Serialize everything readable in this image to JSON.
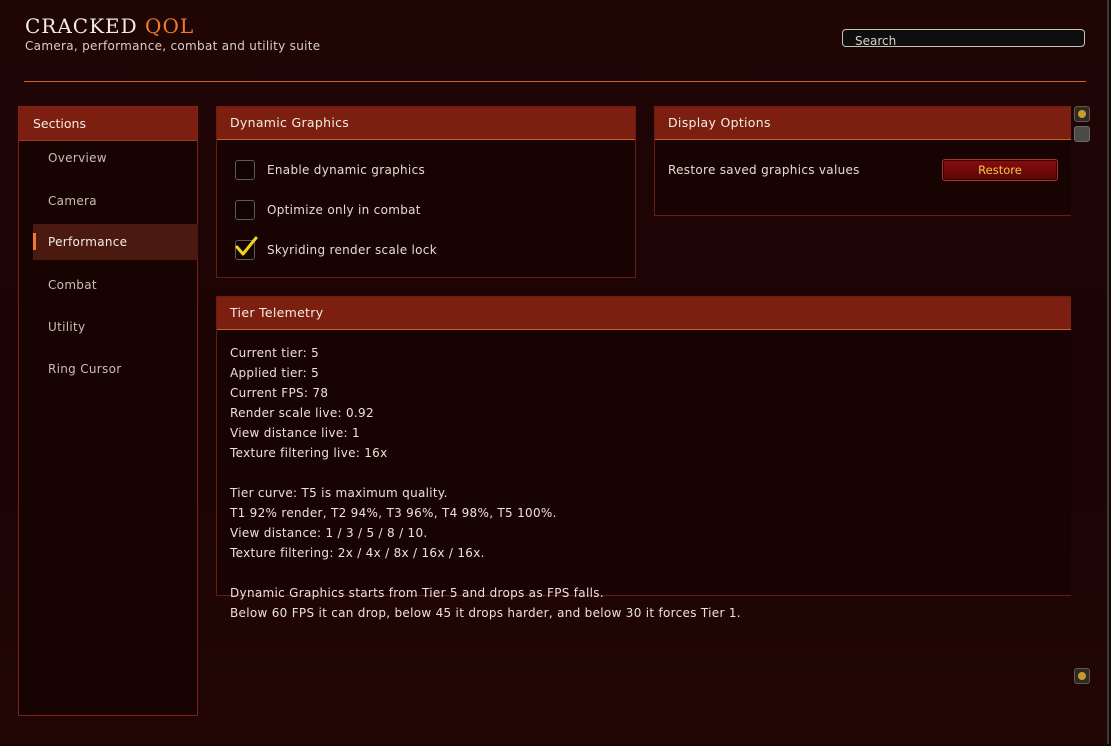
{
  "header": {
    "title_main": "CRACKED",
    "title_accent": "QOL",
    "subtitle": "Camera, performance, combat and utility suite",
    "search_placeholder": "Search"
  },
  "sidebar": {
    "heading": "Sections",
    "items": [
      {
        "label": "Overview",
        "active": false
      },
      {
        "label": "Camera",
        "active": false
      },
      {
        "label": "Performance",
        "active": true
      },
      {
        "label": "Combat",
        "active": false
      },
      {
        "label": "Utility",
        "active": false
      },
      {
        "label": "Ring Cursor",
        "active": false
      }
    ]
  },
  "dynamic_graphics": {
    "heading": "Dynamic Graphics",
    "options": [
      {
        "label": "Enable dynamic graphics",
        "checked": false
      },
      {
        "label": "Optimize only in combat",
        "checked": false
      },
      {
        "label": "Skyriding render scale lock",
        "checked": true
      }
    ]
  },
  "display_options": {
    "heading": "Display Options",
    "restore_label": "Restore saved graphics values",
    "restore_button": "Restore"
  },
  "telemetry": {
    "heading": "Tier Telemetry",
    "lines": [
      "Current tier: 5",
      "Applied tier: 5",
      "Current FPS: 78",
      "Render scale live: 0.92",
      "View distance live: 1",
      "Texture filtering live: 16x",
      "",
      "Tier curve: T5 is maximum quality.",
      "T1 92% render, T2 94%, T3 96%, T4 98%, T5 100%.",
      "View distance: 1 / 3 / 5 / 8 / 10.",
      "Texture filtering: 2x / 4x / 8x / 16x / 16x.",
      "",
      "Dynamic Graphics starts from Tier 5 and drops as FPS falls.",
      "Below 60 FPS it can drop, below 45 it drops harder, and below 30 it forces Tier 1."
    ]
  },
  "colors": {
    "accent": "#f07a2a",
    "panel_header": "#7c1f10",
    "background": "#1c0404",
    "button_text": "#f2c84a"
  }
}
